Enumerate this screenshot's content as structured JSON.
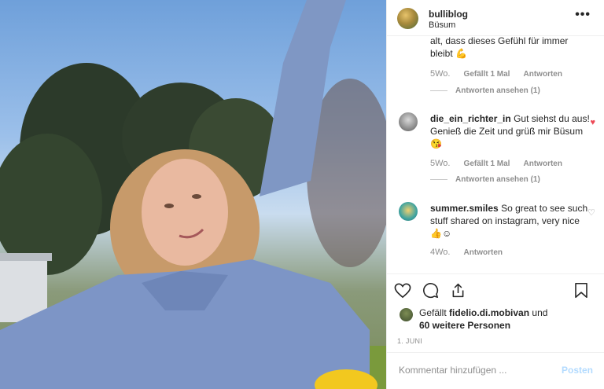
{
  "post": {
    "username": "bulliblog",
    "location": "Büsum"
  },
  "comments": [
    {
      "text_fragment": "alt, dass dieses Gefühl für immer bleibt 💪",
      "age": "5Wo.",
      "likes": "Gefällt 1 Mal",
      "reply_label": "Antworten",
      "view_replies": "Antworten ansehen (1)"
    },
    {
      "user": "die_ein_richter_in",
      "text": "Gut siehst du aus! Genieß die Zeit und grüß mir Büsum😘",
      "age": "5Wo.",
      "likes": "Gefällt 1 Mal",
      "reply_label": "Antworten",
      "view_replies": "Antworten ansehen (1)",
      "liked": true
    },
    {
      "user": "summer.smiles",
      "text": "So great to see such stuff shared on instagram, very nice 👍☺",
      "age": "4Wo.",
      "reply_label": "Antworten",
      "liked": false
    }
  ],
  "actions": {
    "likes_prefix": "Gefällt",
    "liked_by": "fidelio.di.mobivan",
    "likes_and": "und",
    "others": "60 weitere Personen",
    "date": "1. JUNI"
  },
  "comment_box": {
    "placeholder": "Kommentar hinzufügen ...",
    "post_label": "Posten"
  },
  "icons": [
    "heart-icon",
    "comment-icon",
    "share-icon",
    "bookmark-icon",
    "more-icon"
  ],
  "colors": {
    "liked_red": "#ed4956",
    "post_blue": "#b3dbff",
    "meta_gray": "#8e8e8e"
  }
}
